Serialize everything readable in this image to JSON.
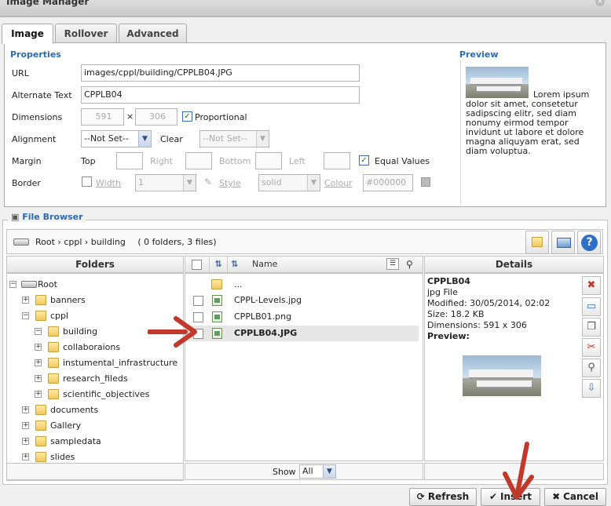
{
  "window": {
    "title": "Image Manager"
  },
  "tabs": [
    {
      "label": "Image"
    },
    {
      "label": "Rollover"
    },
    {
      "label": "Advanced"
    }
  ],
  "properties": {
    "title": "Properties",
    "url_label": "URL",
    "url_value": "images/cppl/building/CPPLB04.JPG",
    "alt_label": "Alternate Text",
    "alt_value": "CPPLB04",
    "dimensions_label": "Dimensions",
    "width_value": "591",
    "times": "×",
    "height_value": "306",
    "proportional_label": "Proportional",
    "alignment_label": "Alignment",
    "alignment_value": "--Not Set--",
    "clear_label": "Clear",
    "clear_value": "--Not Set--",
    "margin_label": "Margin",
    "top_label": "Top",
    "right_label": "Right",
    "bottom_label": "Bottom",
    "left_label": "Left",
    "equal_values_label": "Equal Values",
    "border_label": "Border",
    "border_width_label": "Width",
    "border_width_value": "1",
    "border_style_label": "Style",
    "border_style_value": "solid",
    "border_colour_label": "Colour",
    "border_colour_value": "#000000"
  },
  "preview": {
    "title": "Preview",
    "text": "Lorem ipsum dolor sit amet, consetetur sadipscing elitr, sed diam nonumy eirmod tempor invidunt ut labore et dolore magna aliquyam erat, sed diam voluptua."
  },
  "file_browser": {
    "title": "File Browser",
    "path": "Root › cppl › building",
    "summary": "( 0 folders, 3 files)",
    "folders_header": "Folders",
    "name_header": "Name",
    "details_header": "Details",
    "tree": {
      "root": "Root",
      "banners": "banners",
      "cppl": "cppl",
      "building": "building",
      "collaboraions": "collaboraions",
      "instumental_infrastructure": "instumental_infrastructure",
      "research_fileds": "research_fileds",
      "scientific_objectives": "scientific_objectives",
      "documents": "documents",
      "gallery": "Gallery",
      "sampledata": "sampledata",
      "slides": "slides"
    },
    "files": {
      "up": "...",
      "f1": "CPPL-Levels.jpg",
      "f2": "CPPLB01.png",
      "f3": "CPPLB04.JPG"
    },
    "details": {
      "name": "CPPLB04",
      "type": "jpg File",
      "modified": "Modified: 30/05/2014, 02:02",
      "size": "Size: 18.2 KB",
      "dimensions": "Dimensions: 591 x 306",
      "preview_label": "Preview:"
    },
    "show_label": "Show",
    "show_value": "All"
  },
  "buttons": {
    "refresh": "Refresh",
    "insert": "Insert",
    "cancel": "Cancel"
  },
  "colors": {
    "accent": "#2a6bb0",
    "arrow": "#c0392b"
  }
}
